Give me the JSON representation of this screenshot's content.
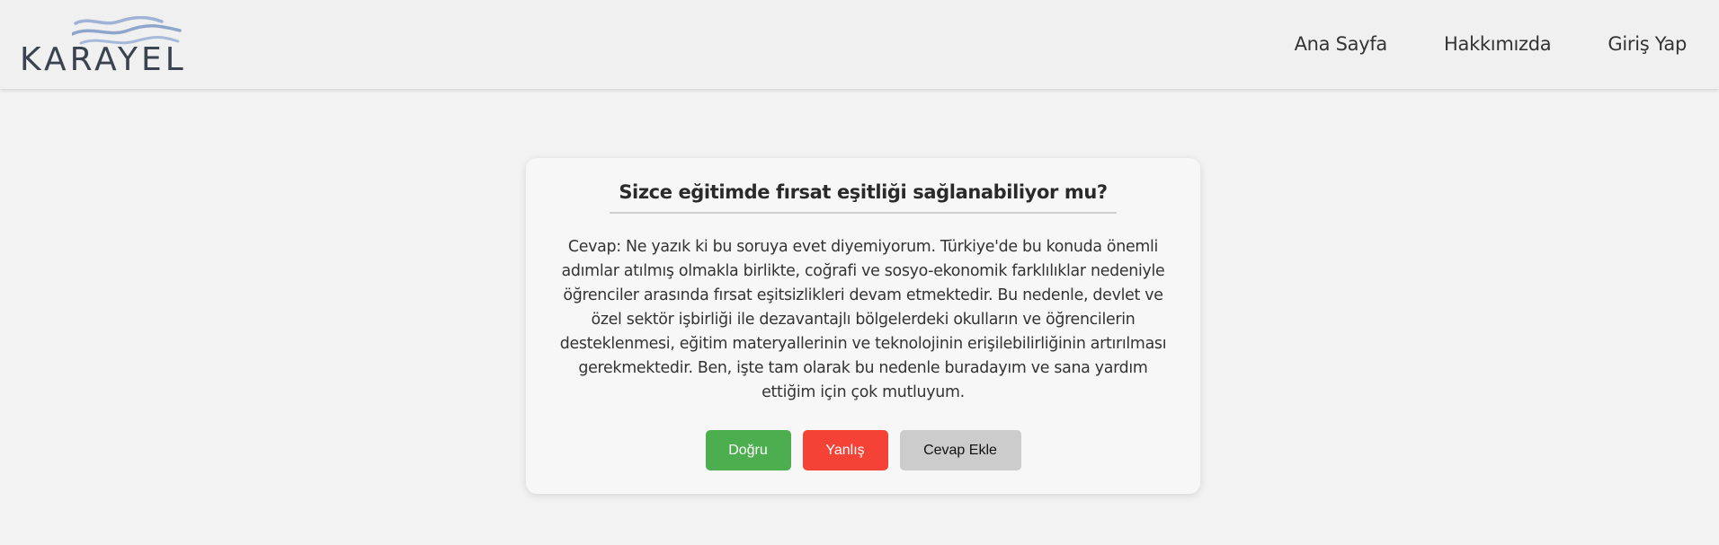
{
  "header": {
    "logo_text": "KARAYEL",
    "nav": [
      "Ana Sayfa",
      "Hakkımızda",
      "Giriş Yap"
    ]
  },
  "card": {
    "question": "Sizce eğitimde fırsat eşitliği sağlanabiliyor mu?",
    "answer": "Cevap: Ne yazık ki bu soruya evet diyemiyorum. Türkiye'de bu konuda önemli adımlar atılmış olmakla birlikte, coğrafi ve sosyo-ekonomik farklılıklar nedeniyle öğrenciler arasında fırsat eşitsizlikleri devam etmektedir. Bu nedenle, devlet ve özel sektör işbirliği ile dezavantajlı bölgelerdeki okulların ve öğrencilerin desteklenmesi, eğitim materyallerinin ve teknolojinin erişilebilirliğinin artırılması gerekmektedir. Ben, işte tam olarak bu nedenle buradayım ve sana yardım ettiğim için çok mutluyum.",
    "buttons": {
      "true_label": "Doğru",
      "false_label": "Yanlış",
      "add_label": "Cevap Ekle"
    }
  },
  "colors": {
    "true_button": "#4cae4f",
    "false_button": "#f44336",
    "add_button": "#cccccc",
    "logo_waves": "#8fa6cc",
    "logo_text": "#3b4250"
  }
}
